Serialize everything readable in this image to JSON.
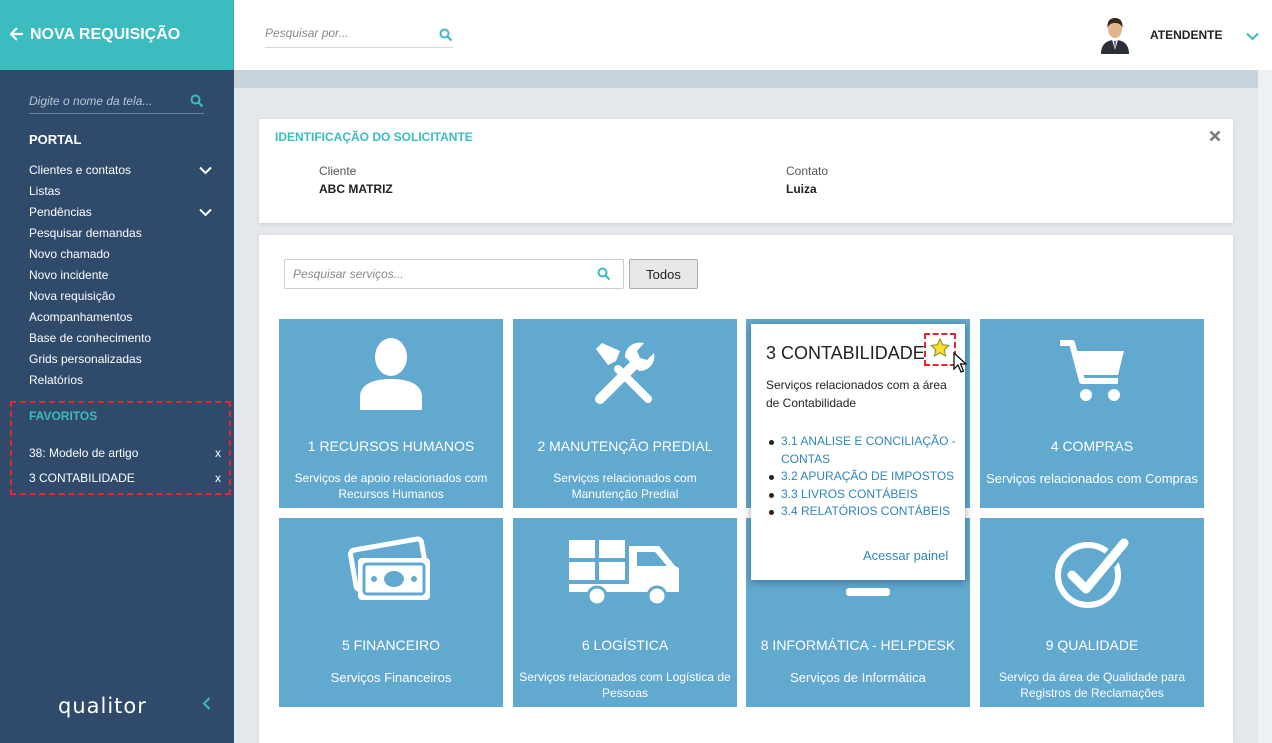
{
  "sidebar": {
    "header": {
      "back_icon": "arrow-left-icon",
      "title": "NOVA REQUISIÇÃO"
    },
    "search": {
      "placeholder": "Digite o nome da tela..."
    },
    "section_title": "PORTAL",
    "menu": [
      {
        "label": "Clientes e contatos",
        "expandable": true
      },
      {
        "label": "Listas",
        "expandable": false
      },
      {
        "label": "Pendências",
        "expandable": true
      },
      {
        "label": "Pesquisar demandas",
        "expandable": false
      },
      {
        "label": "Novo chamado",
        "expandable": false
      },
      {
        "label": "Novo incidente",
        "expandable": false
      },
      {
        "label": "Nova requisição",
        "expandable": false
      },
      {
        "label": "Acompanhamentos",
        "expandable": false
      },
      {
        "label": "Base de conhecimento",
        "expandable": false
      },
      {
        "label": "Grids personalizadas",
        "expandable": false
      },
      {
        "label": "Relatórios",
        "expandable": false
      }
    ],
    "favorites": {
      "title": "FAVORITOS",
      "items": [
        {
          "label": "38: Modelo de artigo",
          "remove": "x"
        },
        {
          "label": "3 CONTABILIDADE",
          "remove": "x"
        }
      ]
    },
    "logo": "qualitor",
    "collapse_icon": "chevron-left-icon"
  },
  "topbar": {
    "search": {
      "placeholder": "Pesquisar por..."
    },
    "user": {
      "name": "ATENDENTE",
      "avatar_icon": "avatar-icon"
    }
  },
  "solicitante": {
    "title": "IDENTIFICAÇÃO DO SOLICITANTE",
    "close_icon": "close-icon",
    "cliente_label": "Cliente",
    "cliente_value": "ABC MATRIZ",
    "contato_label": "Contato",
    "contato_value": "Luiza"
  },
  "services": {
    "search_placeholder": "Pesquisar serviços...",
    "filter_button": "Todos",
    "tiles": [
      {
        "title": "1 RECURSOS HUMANOS",
        "desc": "Serviços de apoio relacionados com Recursos Humanos",
        "icon": "user-icon"
      },
      {
        "title": "2 MANUTENÇÃO PREDIAL",
        "desc": "Serviços relacionados com Manutenção Predial",
        "icon": "tools-icon"
      },
      {
        "title": "3 CONTABILIDADE",
        "desc": "",
        "icon": "calculator-icon"
      },
      {
        "title": "4 COMPRAS",
        "desc": "Serviços relacionados com Compras",
        "icon": "cart-icon"
      },
      {
        "title": "5 FINANCEIRO",
        "desc": "Serviços Financeiros",
        "icon": "money-icon"
      },
      {
        "title": "6 LOGÍSTICA",
        "desc": "Serviços relacionados com Logística de Pessoas",
        "icon": "truck-icon"
      },
      {
        "title": "8 INFORMÁTICA - HELPDESK",
        "desc": "Serviços de Informática",
        "icon": "computer-icon"
      },
      {
        "title": "9 QUALIDADE",
        "desc": "Serviço da área de Qualidade para Registros de Reclamações",
        "icon": "check-circle-icon"
      }
    ],
    "popup": {
      "title": "3 CONTABILIDADE",
      "star_icon": "star-icon",
      "desc": "Serviços relacionados com a área de Contabilidade",
      "items": [
        "3.1 ANALISE E CONCILIAÇÃO - CONTAS",
        "3.2 APURAÇÃO DE IMPOSTOS",
        "3.3 LIVROS CONTÁBEIS",
        "3.4 RELATÓRIOS CONTÁBEIS"
      ],
      "link": "Acessar painel"
    }
  },
  "colors": {
    "sidebar_bg": "#2f4a6a",
    "accent": "#3bbcbf",
    "tile_bg": "#62a9d0",
    "link": "#2e86b8",
    "highlight": "#e4262d",
    "star": "#f5e12a"
  }
}
